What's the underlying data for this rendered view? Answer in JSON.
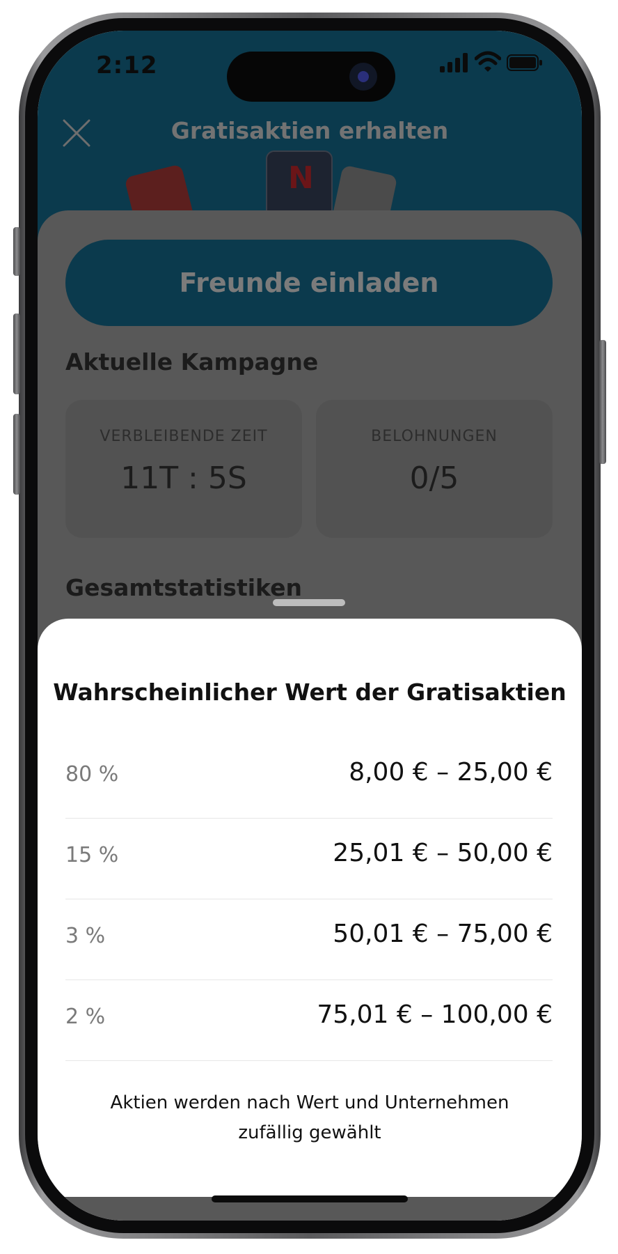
{
  "status_bar": {
    "time": "2:12"
  },
  "header": {
    "title": "Gratisaktien erhalten"
  },
  "main": {
    "invite_button_label": "Freunde einladen",
    "current_campaign": {
      "title": "Aktuelle Kampagne",
      "remaining_time_label": "VERBLEIBENDE ZEIT",
      "remaining_time_value": "11T : 5S",
      "rewards_label": "BELOHNUNGEN",
      "rewards_value": "0/5"
    },
    "overall_stats_title": "Gesamtstatistiken"
  },
  "sheet": {
    "title": "Wahrscheinlicher Wert der Gratisaktien",
    "rows": [
      {
        "percent": "80 %",
        "range": "8,00 € – 25,00 €"
      },
      {
        "percent": "15 %",
        "range": "25,01 € – 50,00 €"
      },
      {
        "percent": "3 %",
        "range": "50,01 € – 75,00 €"
      },
      {
        "percent": "2 %",
        "range": "75,01 € – 100,00 €"
      }
    ],
    "footnote": "Aktien werden nach Wert und Unternehmen zufällig gewählt"
  },
  "colors": {
    "brand_dark_teal": "#0b3a4d",
    "overlay_gray": "#585858",
    "sheet_background": "#ffffff"
  },
  "icons": [
    "close-icon",
    "signal-icon",
    "wifi-icon",
    "battery-icon"
  ]
}
